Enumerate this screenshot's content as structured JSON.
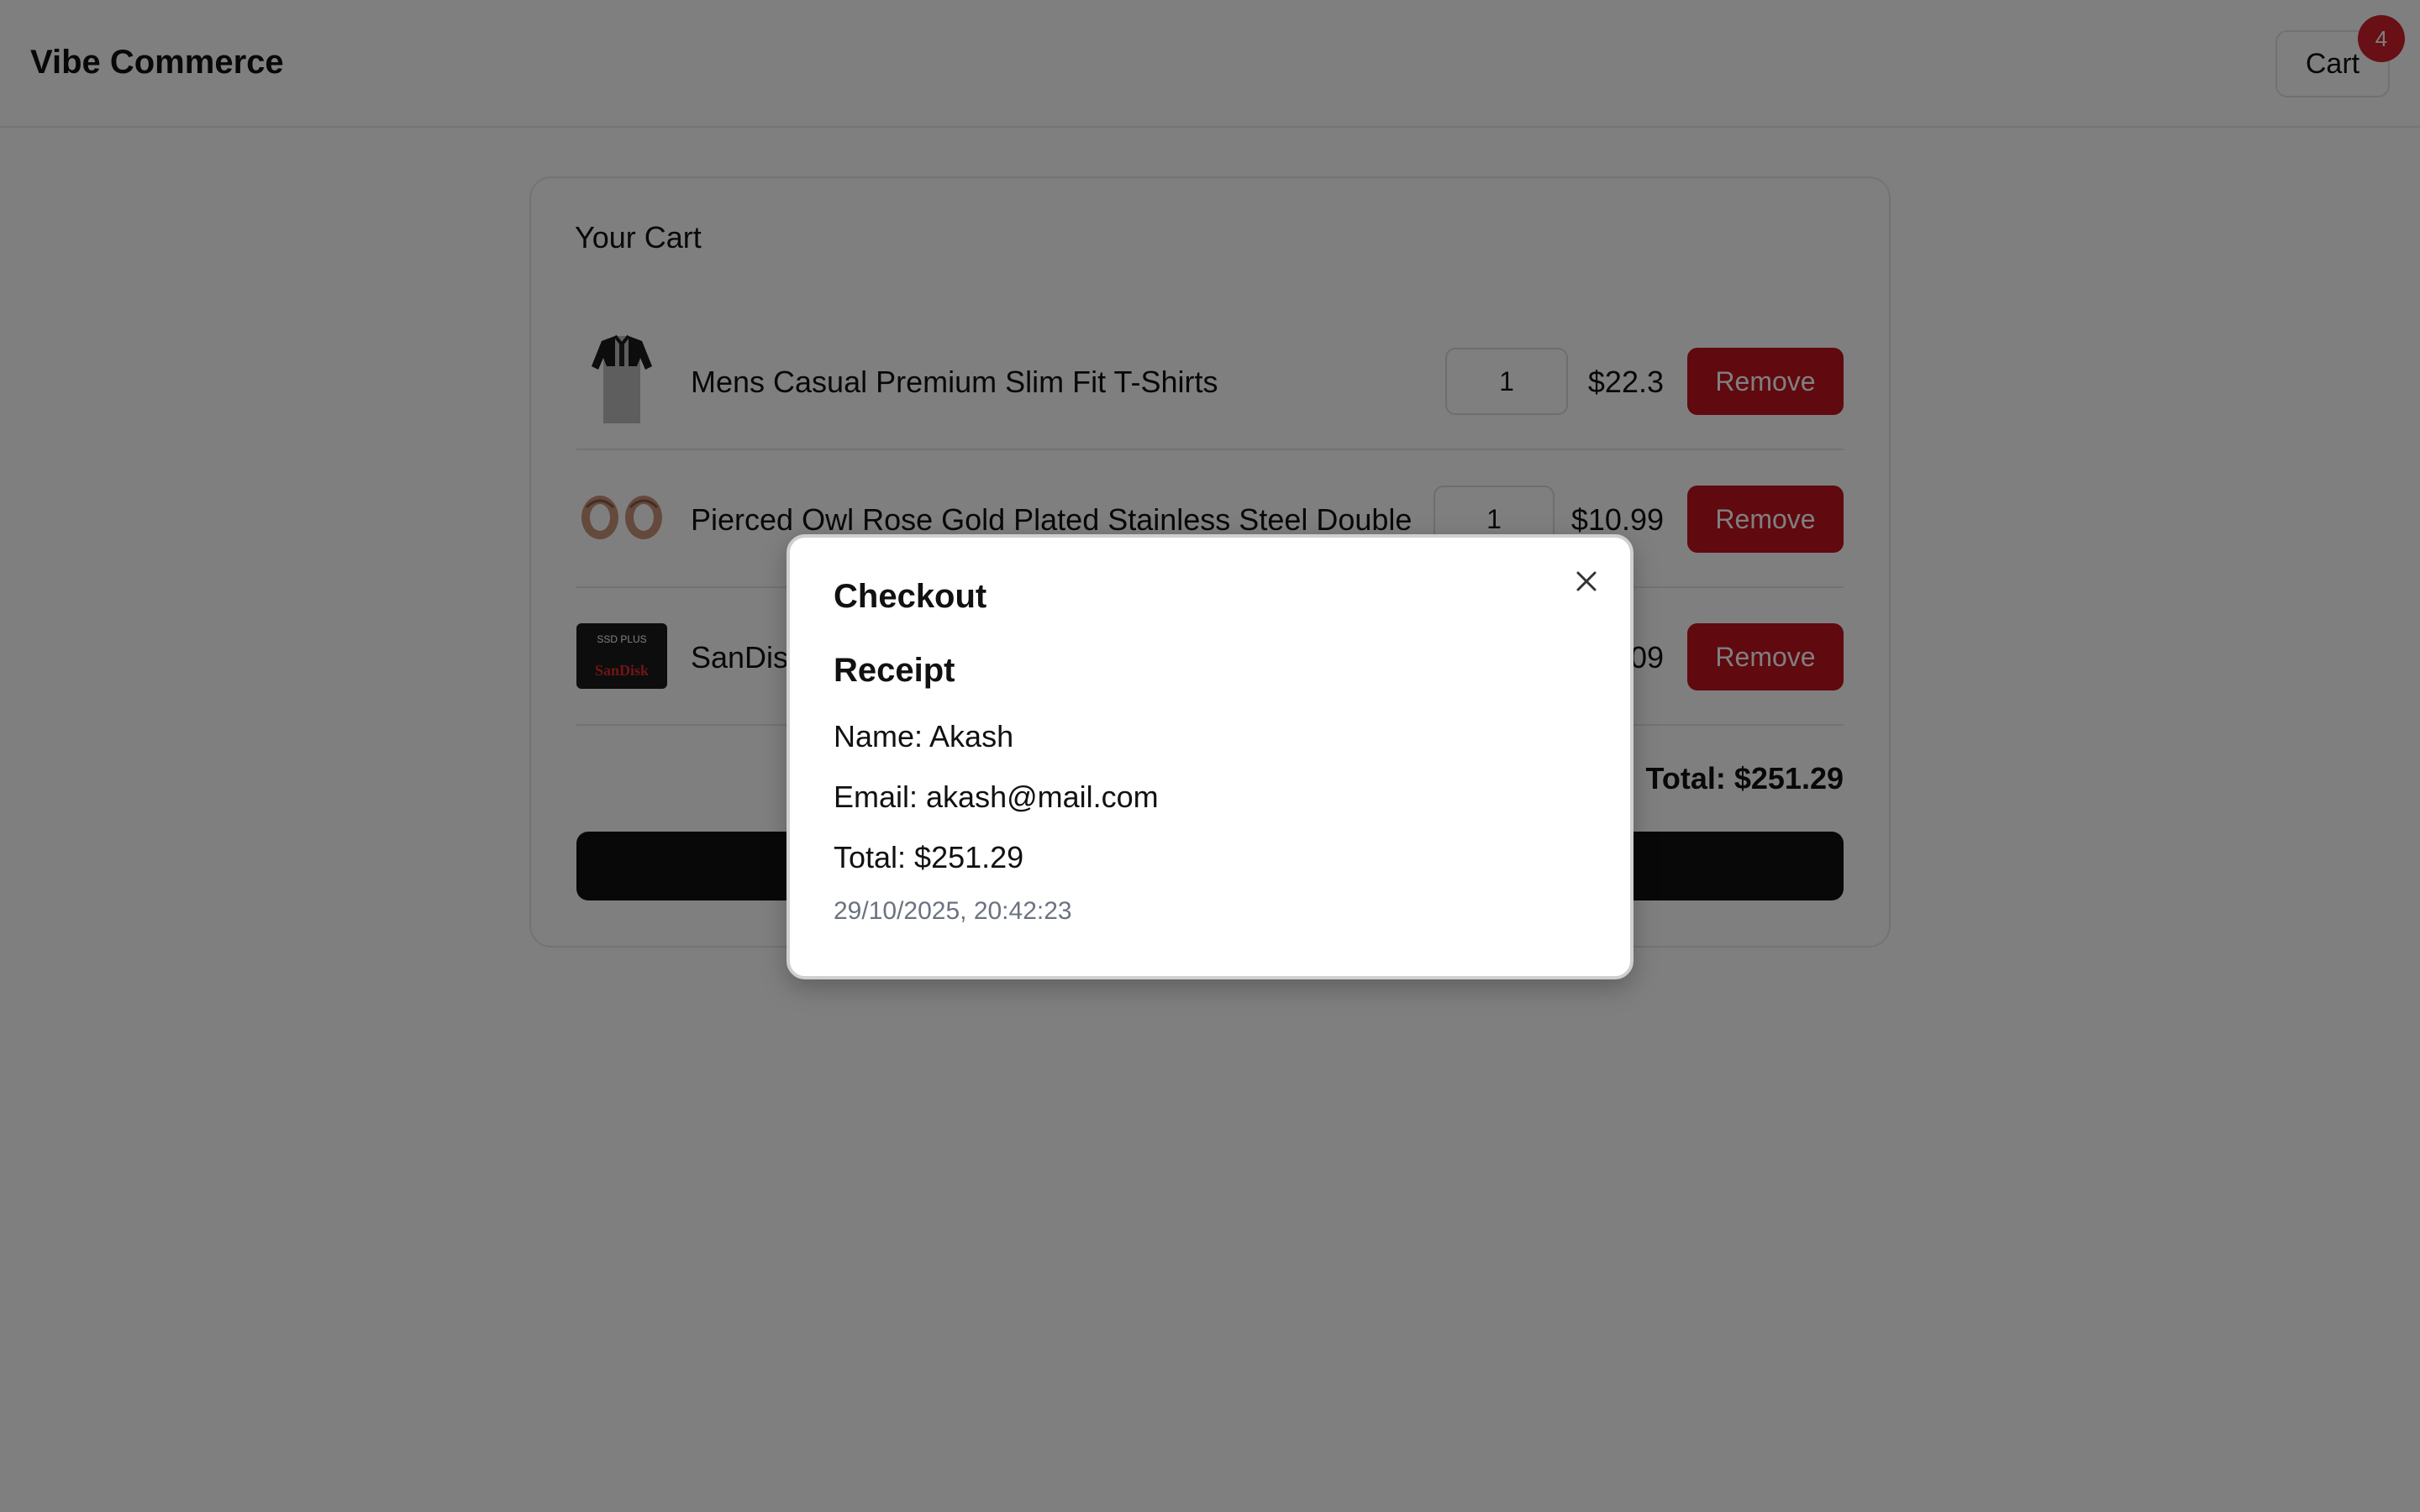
{
  "header": {
    "brand": "Vibe Commerce",
    "cart_label": "Cart",
    "cart_count": "4"
  },
  "cart": {
    "title": "Your Cart",
    "items": [
      {
        "name": "Mens Casual Premium Slim Fit T-Shirts",
        "qty": "1",
        "price": "$22.3",
        "remove_label": "Remove",
        "thumb_icon": "tshirt-icon"
      },
      {
        "name": "Pierced Owl Rose Gold Plated Stainless Steel Double",
        "qty": "1",
        "price": "$10.99",
        "remove_label": "Remove",
        "thumb_icon": "rings-icon"
      },
      {
        "name": "SanDisk",
        "qty": "",
        "price": "09",
        "remove_label": "Remove",
        "thumb_icon": "ssd-icon",
        "thumb_text_top": "SSD PLUS",
        "thumb_text_brand": "SanDisk"
      }
    ],
    "total": "Total: $251.29",
    "checkout_label": ""
  },
  "modal": {
    "title": "Checkout",
    "receipt_heading": "Receipt",
    "name_line": "Name: Akash",
    "email_line": "Email: akash@mail.com",
    "total_line": "Total: $251.29",
    "timestamp": "29/10/2025, 20:42:23"
  },
  "colors": {
    "danger": "#c1121f",
    "badge": "#d1212b",
    "dark": "#111111",
    "muted": "#6b7280"
  }
}
